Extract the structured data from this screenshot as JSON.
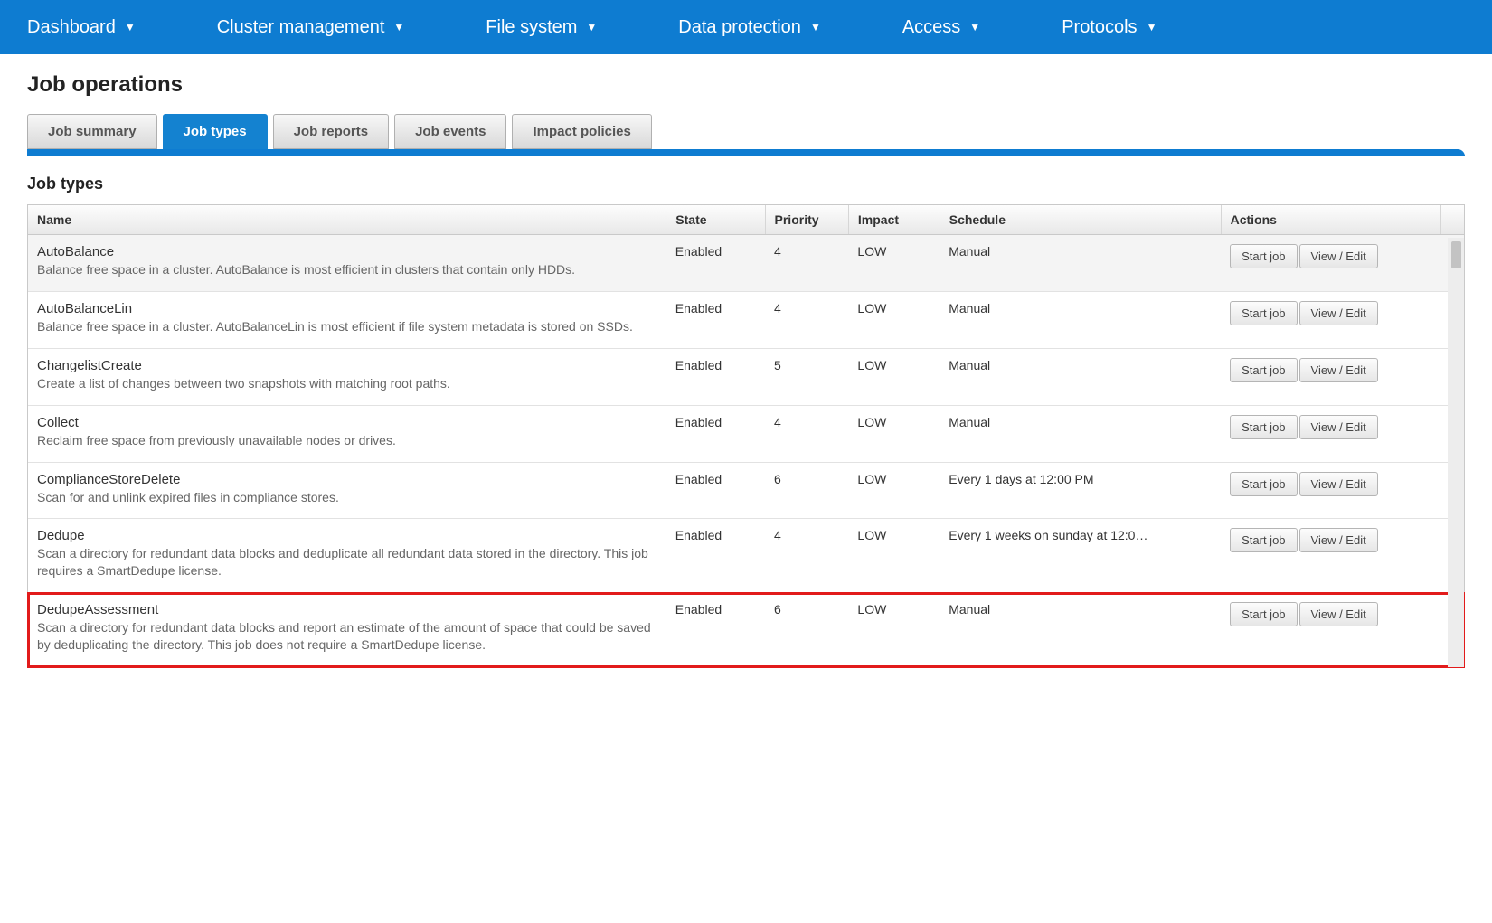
{
  "nav": [
    {
      "label": "Dashboard"
    },
    {
      "label": "Cluster management"
    },
    {
      "label": "File system"
    },
    {
      "label": "Data protection"
    },
    {
      "label": "Access"
    },
    {
      "label": "Protocols"
    }
  ],
  "page_title": "Job operations",
  "tabs": [
    {
      "label": "Job summary"
    },
    {
      "label": "Job types"
    },
    {
      "label": "Job reports"
    },
    {
      "label": "Job events"
    },
    {
      "label": "Impact policies"
    }
  ],
  "active_tab_index": 1,
  "section_title": "Job types",
  "columns": [
    "Name",
    "State",
    "Priority",
    "Impact",
    "Schedule",
    "Actions"
  ],
  "action_labels": {
    "start": "Start job",
    "edit": "View / Edit"
  },
  "rows": [
    {
      "name": "AutoBalance",
      "desc": "Balance free space in a cluster. AutoBalance is most efficient in clusters that contain only HDDs.",
      "state": "Enabled",
      "priority": "4",
      "impact": "LOW",
      "schedule": "Manual",
      "alt": true
    },
    {
      "name": "AutoBalanceLin",
      "desc": "Balance free space in a cluster. AutoBalanceLin is most efficient if file system metadata is stored on SSDs.",
      "state": "Enabled",
      "priority": "4",
      "impact": "LOW",
      "schedule": "Manual"
    },
    {
      "name": "ChangelistCreate",
      "desc": "Create a list of changes between two snapshots with matching root paths.",
      "state": "Enabled",
      "priority": "5",
      "impact": "LOW",
      "schedule": "Manual"
    },
    {
      "name": "Collect",
      "desc": "Reclaim free space from previously unavailable nodes or drives.",
      "state": "Enabled",
      "priority": "4",
      "impact": "LOW",
      "schedule": "Manual"
    },
    {
      "name": "ComplianceStoreDelete",
      "desc": "Scan for and unlink expired files in compliance stores.",
      "state": "Enabled",
      "priority": "6",
      "impact": "LOW",
      "schedule": "Every 1 days at 12:00 PM"
    },
    {
      "name": "Dedupe",
      "desc": "Scan a directory for redundant data blocks and deduplicate all redundant data stored in the directory. This job requires a SmartDedupe license.",
      "state": "Enabled",
      "priority": "4",
      "impact": "LOW",
      "schedule": "Every 1 weeks on sunday at 12:0…"
    },
    {
      "name": "DedupeAssessment",
      "desc": "Scan a directory for redundant data blocks and report an estimate of the amount of space that could be saved by deduplicating the directory. This job does not require a SmartDedupe license.",
      "state": "Enabled",
      "priority": "6",
      "impact": "LOW",
      "schedule": "Manual",
      "highlight": true
    }
  ]
}
